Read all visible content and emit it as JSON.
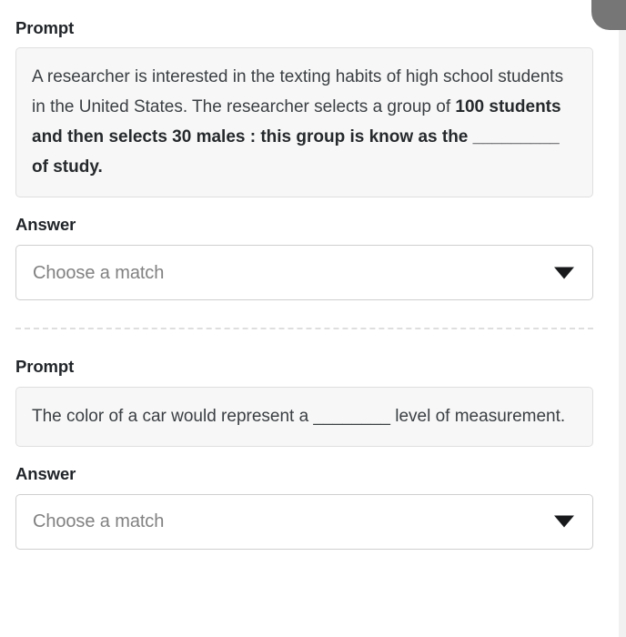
{
  "page": {
    "background": "#ffffff",
    "prompt_box_bg": "#f7f7f7",
    "accent_text": "#212529",
    "placeholder_color": "#818181",
    "scrollbar_thumb_color": "#767676"
  },
  "items": [
    {
      "prompt_label": "Prompt",
      "prompt_text_plain": "A researcher is interested in the texting habits of high school students in the United States. The researcher selects a group of ",
      "prompt_text_bold": "100 students and then selects 30 males : this group is know as the _________ of study.",
      "answer_label": "Answer",
      "answer_placeholder": "Choose a match",
      "answer_value": "",
      "caret_icon": "chevron-down-icon"
    },
    {
      "prompt_label": "Prompt",
      "prompt_text_plain": "The color of a car would represent a ________ level of measurement.",
      "prompt_text_bold": "",
      "answer_label": "Answer",
      "answer_placeholder": "Choose a match",
      "answer_value": "",
      "caret_icon": "chevron-down-icon"
    }
  ],
  "scrollbar": {
    "name": "vertical-scrollbar",
    "position": "top-right"
  }
}
